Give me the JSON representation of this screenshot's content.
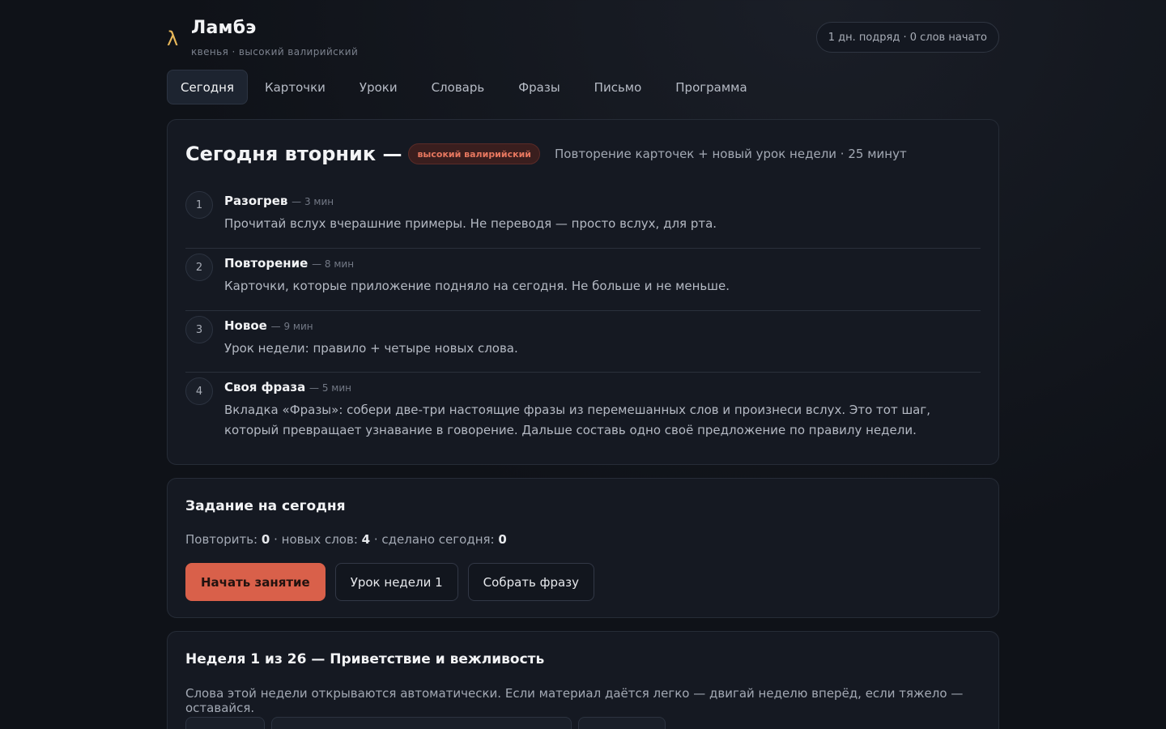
{
  "header": {
    "logo": "λ",
    "title": "Ламбэ",
    "subtitle": "квенья · высокий валирийский",
    "streak": "1 дн. подряд · 0 слов начато"
  },
  "tabs": [
    {
      "label": "Сегодня",
      "active": true
    },
    {
      "label": "Карточки"
    },
    {
      "label": "Уроки"
    },
    {
      "label": "Словарь"
    },
    {
      "label": "Фразы"
    },
    {
      "label": "Письмо"
    },
    {
      "label": "Программа"
    }
  ],
  "plan": {
    "title": "Сегодня вторник —",
    "badge": "высокий валирийский",
    "meta": "Повторение карточек + новый урок недели · 25 минут",
    "steps": [
      {
        "num": "1",
        "title": "Разогрев",
        "duration": "— 3 мин",
        "desc": "Прочитай вслух вчерашние примеры. Не переводя — просто вслух, для рта."
      },
      {
        "num": "2",
        "title": "Повторение",
        "duration": "— 8 мин",
        "desc": "Карточки, которые приложение подняло на сегодня. Не больше и не меньше."
      },
      {
        "num": "3",
        "title": "Новое",
        "duration": "— 9 мин",
        "desc": "Урок недели: правило + четыре новых слова."
      },
      {
        "num": "4",
        "title": "Своя фраза",
        "duration": "— 5 мин",
        "desc": "Вкладка «Фразы»: собери две-три настоящие фразы из перемешанных слов и произнеси вслух. Это тот шаг, который превращает узнавание в говорение. Дальше составь одно своё предложение по правилу недели."
      }
    ]
  },
  "task": {
    "title": "Задание на сегодня",
    "review_label": "Повторить:",
    "review_value": "0",
    "new_label": "· новых слов:",
    "new_value": "4",
    "done_label": "· сделано сегодня:",
    "done_value": "0",
    "start_button": "Начать занятие",
    "lesson_button": "Урок недели 1",
    "phrase_button": "Собрать фразу"
  },
  "week": {
    "title": "Неделя 1 из 26 — Приветствие и вежливость",
    "desc": "Слова этой недели открываются автоматически. Если материал даётся легко — двигай неделю вперёд, если тяжело — оставайся."
  },
  "colors": {
    "accent": "#d9604a",
    "logo": "#e8b85a",
    "background": "#0f1218",
    "card": "#151922"
  }
}
